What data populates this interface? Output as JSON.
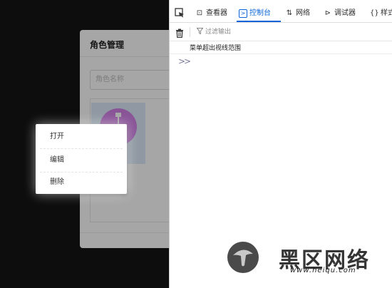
{
  "dialog": {
    "title": "角色管理",
    "search_placeholder": "角色名称"
  },
  "context_menu": {
    "items": [
      {
        "label": "打开"
      },
      {
        "label": "编辑"
      },
      {
        "label": "删除"
      }
    ]
  },
  "devtools": {
    "tabs": [
      {
        "label": "查看器",
        "icon": "inspector-icon"
      },
      {
        "label": "控制台",
        "icon": "console-icon",
        "active": true
      },
      {
        "label": "网络",
        "icon": "network-icon"
      },
      {
        "label": "调试器",
        "icon": "debugger-icon"
      },
      {
        "label": "样式",
        "icon": "style-editor-icon"
      }
    ],
    "filter_placeholder": "过滤输出",
    "console_messages": [
      {
        "text": "菜单超出视线范围"
      }
    ],
    "accent_color": "#0a63d8"
  },
  "watermark": {
    "brand": "黑区网络",
    "url": "www.heiqu.com"
  }
}
